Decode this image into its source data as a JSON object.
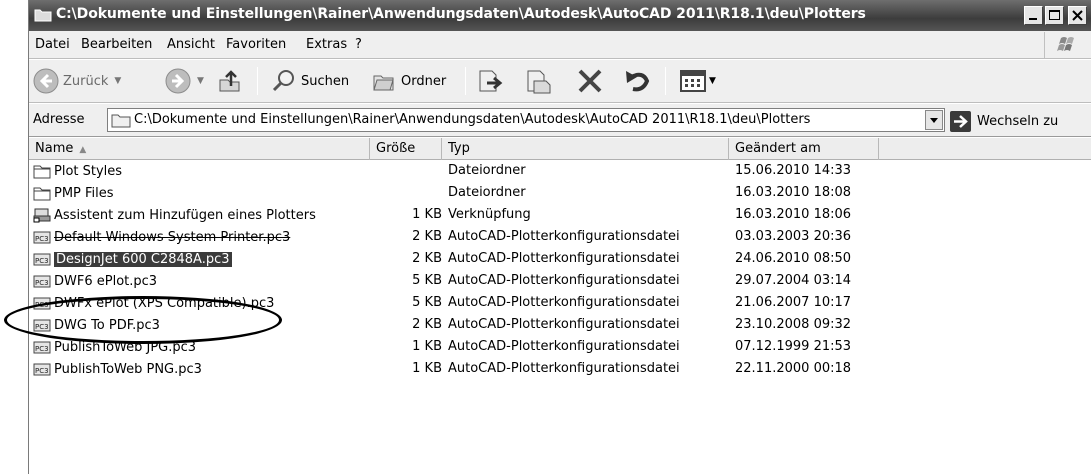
{
  "window": {
    "title": "C:\\Dokumente und Einstellungen\\Rainer\\Anwendungsdaten\\Autodesk\\AutoCAD 2011\\R18.1\\deu\\Plotters"
  },
  "menu": [
    "Datei",
    "Bearbeiten",
    "Ansicht",
    "Favoriten",
    "Extras",
    "?"
  ],
  "toolbar": {
    "back_label": "Zurück",
    "search_label": "Suchen",
    "folders_label": "Ordner"
  },
  "address": {
    "label": "Adresse",
    "value": "C:\\Dokumente und Einstellungen\\Rainer\\Anwendungsdaten\\Autodesk\\AutoCAD 2011\\R18.1\\deu\\Plotters",
    "go_label": "Wechseln zu"
  },
  "columns": {
    "name": "Name",
    "size": "Größe",
    "type": "Typ",
    "modified": "Geändert am"
  },
  "files": [
    {
      "name": "Plot Styles",
      "size": "",
      "type": "Dateiordner",
      "modified": "15.06.2010 14:33",
      "icon": "folder-icon"
    },
    {
      "name": "PMP Files",
      "size": "",
      "type": "Dateiordner",
      "modified": "16.03.2010 18:08",
      "icon": "folder-icon"
    },
    {
      "name": "Assistent zum Hinzufügen eines Plotters",
      "size": "1 KB",
      "type": "Verknüpfung",
      "modified": "16.03.2010 18:06",
      "icon": "plotter-shortcut-icon"
    },
    {
      "name": "Default Windows System Printer.pc3",
      "size": "2 KB",
      "type": "AutoCAD-Plotterkonfigurationsdatei",
      "modified": "03.03.2003 20:36",
      "icon": "pc3-file-icon"
    },
    {
      "name": "DesignJet 600 C2848A.pc3",
      "size": "2 KB",
      "type": "AutoCAD-Plotterkonfigurationsdatei",
      "modified": "24.06.2010 08:50",
      "icon": "pc3-file-icon"
    },
    {
      "name": "DWF6 ePlot.pc3",
      "size": "5 KB",
      "type": "AutoCAD-Plotterkonfigurationsdatei",
      "modified": "29.07.2004 03:14",
      "icon": "pc3-file-icon"
    },
    {
      "name": "DWFx ePlot (XPS Compatible).pc3",
      "size": "5 KB",
      "type": "AutoCAD-Plotterkonfigurationsdatei",
      "modified": "21.06.2007 10:17",
      "icon": "pc3-file-icon"
    },
    {
      "name": "DWG To PDF.pc3",
      "size": "2 KB",
      "type": "AutoCAD-Plotterkonfigurationsdatei",
      "modified": "23.10.2008 09:32",
      "icon": "pc3-file-icon"
    },
    {
      "name": "PublishToWeb JPG.pc3",
      "size": "1 KB",
      "type": "AutoCAD-Plotterkonfigurationsdatei",
      "modified": "07.12.1999 21:53",
      "icon": "pc3-file-icon"
    },
    {
      "name": "PublishToWeb PNG.pc3",
      "size": "1 KB",
      "type": "AutoCAD-Plotterkonfigurationsdatei",
      "modified": "22.11.2000 00:18",
      "icon": "pc3-file-icon"
    }
  ]
}
